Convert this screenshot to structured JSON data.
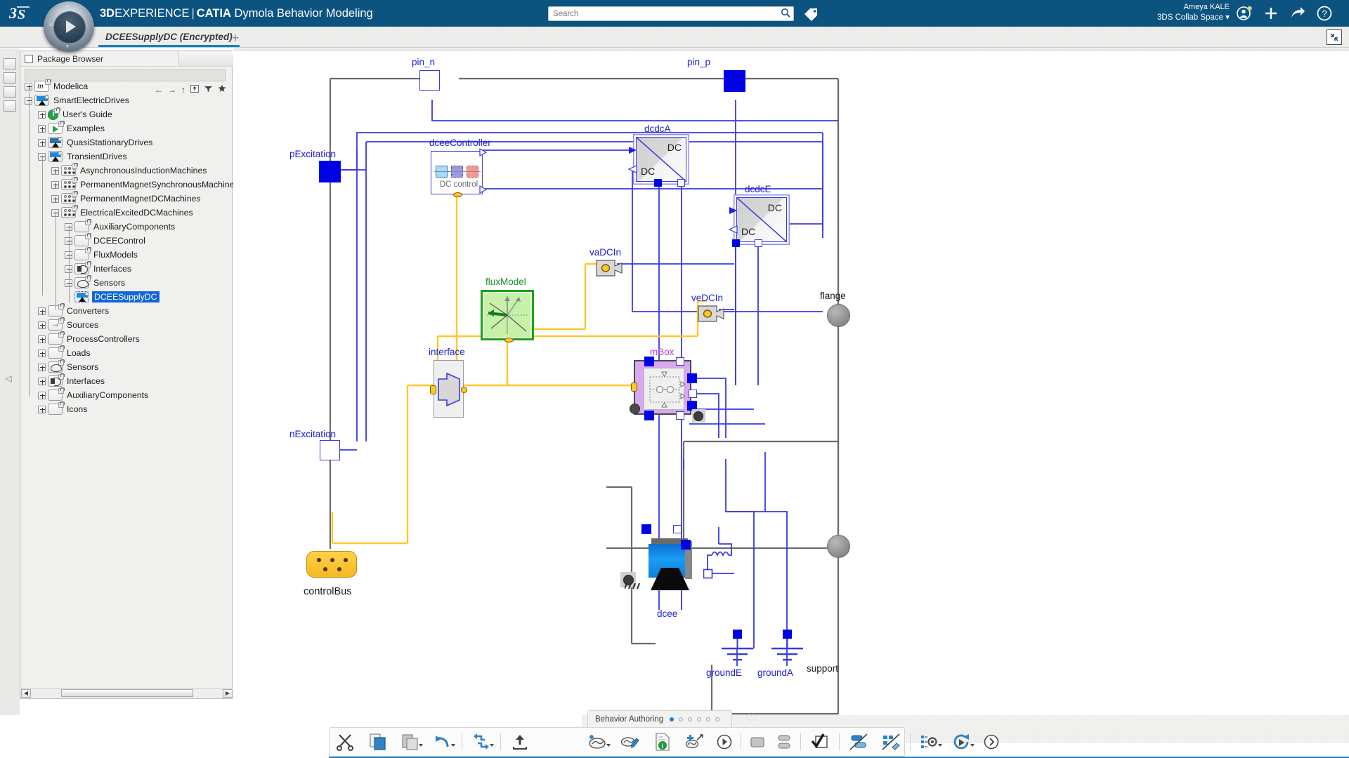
{
  "app": {
    "brand_prefix": "3D",
    "brand_suffix": "EXPERIENCE",
    "separator": "|",
    "product": "CATIA",
    "product_suffix": "Dymola Behavior Modeling",
    "logo_text": "3DS"
  },
  "search": {
    "placeholder": "Search",
    "value": "",
    "icon": "search-icon"
  },
  "user": {
    "name": "Ameya KALE",
    "space": "3DS Collab Space",
    "chevron": "⌄"
  },
  "topbar_icons": [
    "tag-icon",
    "user-avatar-icon",
    "add-icon",
    "share-icon",
    "help-icon"
  ],
  "tab": {
    "title": "DCEESupplyDC (Encrypted)",
    "add_label": "+"
  },
  "panel": {
    "title": "Package Browser",
    "search_value": "",
    "nav_icons": [
      "back-arrow-icon",
      "forward-arrow-icon",
      "up-arrow-icon",
      "up-level-icon",
      "filter-icon",
      "star-icon"
    ]
  },
  "tree": [
    {
      "label": "Modelica",
      "depth": 0,
      "toggle": "plus",
      "icon": "modelica",
      "locked": true
    },
    {
      "label": "SmartElectricDrives",
      "depth": 0,
      "toggle": "minus",
      "icon": "drive",
      "locked": true
    },
    {
      "label": "User's Guide",
      "depth": 1,
      "toggle": "plus",
      "icon": "info",
      "locked": true
    },
    {
      "label": "Examples",
      "depth": 1,
      "toggle": "plus",
      "icon": "exam",
      "locked": true
    },
    {
      "label": "QuasiStationaryDrives",
      "depth": 1,
      "toggle": "plus",
      "icon": "driveq",
      "locked": true
    },
    {
      "label": "TransientDrives",
      "depth": 1,
      "toggle": "minus",
      "icon": "drive",
      "locked": true
    },
    {
      "label": "AsynchronousInductionMachines",
      "depth": 2,
      "toggle": "plus",
      "icon": "dots",
      "locked": true
    },
    {
      "label": "PermanentMagnetSynchronousMachines",
      "depth": 2,
      "toggle": "plus",
      "icon": "dots",
      "locked": true
    },
    {
      "label": "PermanentMagnetDCMachines",
      "depth": 2,
      "toggle": "plus",
      "icon": "dots",
      "locked": true
    },
    {
      "label": "ElectricalExcitedDCMachines",
      "depth": 2,
      "toggle": "minus",
      "icon": "dots",
      "locked": true
    },
    {
      "label": "AuxiliaryComponents",
      "depth": 3,
      "toggle": "plus",
      "icon": "pkg",
      "locked": true
    },
    {
      "label": "DCEEControl",
      "depth": 3,
      "toggle": "plus",
      "icon": "pkg",
      "locked": true
    },
    {
      "label": "FluxModels",
      "depth": 3,
      "toggle": "plus",
      "icon": "pkg",
      "locked": true
    },
    {
      "label": "Interfaces",
      "depth": 3,
      "toggle": "plus",
      "icon": "iface",
      "locked": true
    },
    {
      "label": "Sensors",
      "depth": 3,
      "toggle": "plus",
      "icon": "sensor",
      "locked": true
    },
    {
      "label": "DCEESupplyDC",
      "depth": 3,
      "toggle": "none",
      "icon": "sel",
      "locked": true,
      "selected": true
    },
    {
      "label": "Converters",
      "depth": 1,
      "toggle": "plus",
      "icon": "pkg",
      "locked": true
    },
    {
      "label": "Sources",
      "depth": 1,
      "toggle": "plus",
      "icon": "src",
      "locked": true
    },
    {
      "label": "ProcessControllers",
      "depth": 1,
      "toggle": "plus",
      "icon": "pkg",
      "locked": true
    },
    {
      "label": "Loads",
      "depth": 1,
      "toggle": "plus",
      "icon": "pkg",
      "locked": true
    },
    {
      "label": "Sensors",
      "depth": 1,
      "toggle": "plus",
      "icon": "sensor",
      "locked": true
    },
    {
      "label": "Interfaces",
      "depth": 1,
      "toggle": "plus",
      "icon": "iface",
      "locked": true
    },
    {
      "label": "AuxiliaryComponents",
      "depth": 1,
      "toggle": "plus",
      "icon": "pkg",
      "locked": true
    },
    {
      "label": "Icons",
      "depth": 1,
      "toggle": "plus",
      "icon": "pkg",
      "locked": true
    }
  ],
  "diagram": {
    "labels": {
      "pin_n": "pin_n",
      "pin_p": "pin_p",
      "pExcitation": "pExcitation",
      "nExcitation": "nExcitation",
      "dceeController": "dceeController",
      "dceeController_inner": "DC control",
      "dcdcA": "dcdcA",
      "dcdcA_top": "DC",
      "dcdcA_bottom": "DC",
      "dcdcE": "dcdcE",
      "dcdcE_top": "DC",
      "dcdcE_bottom": "DC",
      "vaDCIn": "vaDCIn",
      "veDCIn": "veDCIn",
      "fluxModel": "fluxModel",
      "interface": "interface",
      "mBox": "mBox",
      "dcee": "dcee",
      "groundE": "groundE",
      "groundA": "groundA",
      "flange": "flange",
      "support": "support",
      "controlBus": "controlBus"
    },
    "colors": {
      "wire_electrical": "#3a3adf",
      "wire_bus": "#ffc72c",
      "wire_mechanical": "#6b6b6b",
      "label": "#2020d8",
      "mbox_fill": "#d9a8f0",
      "flux_fill": "#c6f2a8",
      "port_filled": "#0000e6"
    }
  },
  "bottom": {
    "behavior_tab": "Behavior Authoring",
    "page_dots": 6,
    "page_active_index": 0,
    "toolbar_left": [
      {
        "name": "cut-button",
        "icon": "scissors-icon",
        "caret": false
      },
      {
        "name": "copy-button",
        "icon": "copy-icon",
        "caret": false
      },
      {
        "name": "paste-button",
        "icon": "paste-icon",
        "caret": true
      },
      {
        "name": "undo-button",
        "icon": "undo-icon",
        "caret": true
      },
      {
        "name": "separator",
        "icon": "separator",
        "caret": false
      },
      {
        "name": "update-button",
        "icon": "refresh-cycle-icon",
        "caret": true
      },
      {
        "name": "separator",
        "icon": "separator",
        "caret": false
      },
      {
        "name": "export-button",
        "icon": "upload-icon",
        "caret": false
      }
    ],
    "toolbar_right": [
      {
        "name": "behavior-model-button",
        "icon": "behavior-icon",
        "caret": true
      },
      {
        "name": "edit-behavior-button",
        "icon": "edit-pencil-icon",
        "caret": false
      },
      {
        "name": "document-info-button",
        "icon": "document-info-icon",
        "caret": false
      },
      {
        "name": "add-behavior-button",
        "icon": "add-behavior-icon",
        "caret": false
      },
      {
        "name": "run-button",
        "icon": "play-circle-icon",
        "caret": false
      },
      {
        "name": "separator",
        "icon": "separator",
        "caret": false
      },
      {
        "name": "rectangle-tool-button",
        "icon": "rectangle-icon",
        "caret": false
      },
      {
        "name": "align-tool-button",
        "icon": "align-icon",
        "caret": false
      },
      {
        "name": "separator",
        "icon": "separator",
        "caret": false
      },
      {
        "name": "check-shape-button",
        "icon": "check-shape-icon",
        "caret": false
      },
      {
        "name": "separator",
        "icon": "separator",
        "caret": false
      },
      {
        "name": "hide-component-button",
        "icon": "hide-component-icon",
        "caret": false
      },
      {
        "name": "hide-3d-button",
        "icon": "hide-3d-icon",
        "caret": false
      },
      {
        "name": "separator",
        "icon": "separator",
        "caret": false
      },
      {
        "name": "settings-button",
        "icon": "gear-config-icon",
        "caret": true
      },
      {
        "name": "simulate-button",
        "icon": "simulate-icon",
        "caret": true
      },
      {
        "name": "more-button",
        "icon": "chevron-right-circle-icon",
        "caret": false
      }
    ]
  }
}
